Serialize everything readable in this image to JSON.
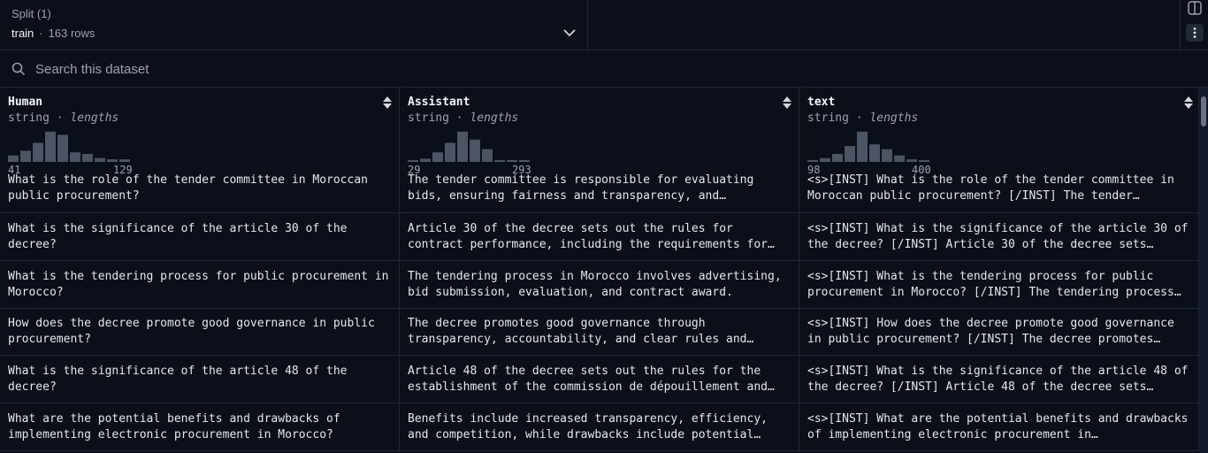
{
  "split": {
    "label": "Split (1)",
    "name": "train",
    "separator": "·",
    "rows": "163 rows"
  },
  "search": {
    "placeholder": "Search this dataset"
  },
  "columns": [
    {
      "name": "Human",
      "type": "string",
      "stat": "lengths",
      "min": "41",
      "max": "129",
      "hist": [
        0.2,
        0.35,
        0.6,
        0.95,
        0.85,
        0.3,
        0.25,
        0.12,
        0.08,
        0.08
      ]
    },
    {
      "name": "Assistant",
      "type": "string",
      "stat": "lengths",
      "min": "29",
      "max": "293",
      "hist": [
        0.05,
        0.1,
        0.3,
        0.6,
        0.95,
        0.7,
        0.4,
        0.05,
        0.05,
        0.05
      ]
    },
    {
      "name": "text",
      "type": "string",
      "stat": "lengths",
      "min": "98",
      "max": "400",
      "hist": [
        0.05,
        0.12,
        0.25,
        0.5,
        0.95,
        0.55,
        0.4,
        0.2,
        0.08,
        0.05
      ]
    }
  ],
  "type_separator": "·",
  "rows": [
    [
      "What is the role of the tender committee in Moroccan public procurement?",
      "The tender committee is responsible for evaluating bids, ensuring fairness and transparency, and…",
      "<s>[INST] What is the role of the tender committee in Moroccan public procurement? [/INST] The tender…"
    ],
    [
      "What is the significance of the article 30 of the decree?",
      "Article 30 of the decree sets out the rules for contract performance, including the requirements for…",
      "<s>[INST] What is the significance of the article 30 of the decree? [/INST] Article 30 of the decree sets…"
    ],
    [
      "What is the tendering process for public procurement in Morocco?",
      "The tendering process in Morocco involves advertising, bid submission, evaluation, and contract award.",
      "<s>[INST] What is the tendering process for public procurement in Morocco? [/INST] The tendering process…"
    ],
    [
      "How does the decree promote good governance in public procurement?",
      "The decree promotes good governance through transparency, accountability, and clear rules and…",
      "<s>[INST] How does the decree promote good governance in public procurement? [/INST] The decree promotes…"
    ],
    [
      "What is the significance of the article 48 of the decree?",
      "Article 48 of the decree sets out the rules for the establishment of the commission de dépouillement and…",
      "<s>[INST] What is the significance of the article 48 of the decree? [/INST] Article 48 of the decree sets…"
    ],
    [
      "What are the potential benefits and drawbacks of implementing electronic procurement in Morocco?",
      "Benefits include increased transparency, efficiency, and competition, while drawbacks include potential…",
      "<s>[INST] What are the potential benefits and drawbacks of implementing electronic procurement in…"
    ]
  ],
  "colors": {
    "bar": "#4b5563",
    "border": "#1f2937",
    "bg": "#0b0f19"
  }
}
